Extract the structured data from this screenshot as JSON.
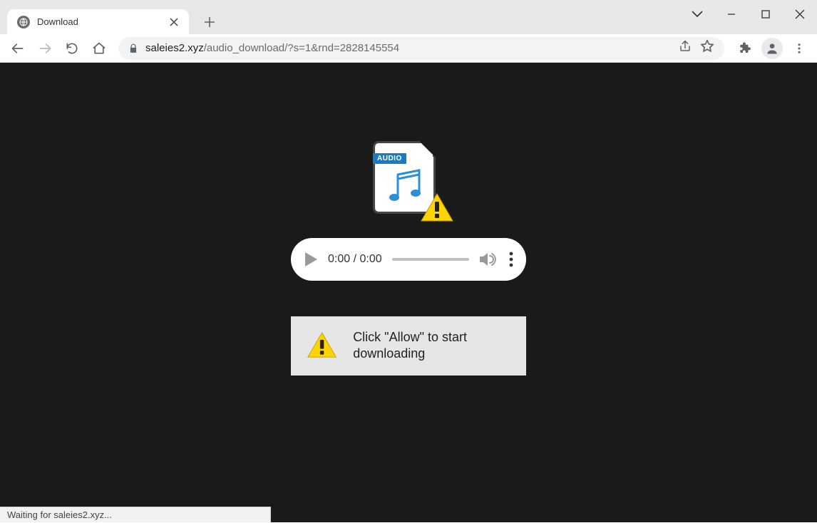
{
  "browser": {
    "tab": {
      "title": "Download"
    },
    "url_host": "saleies2.xyz",
    "url_path": "/audio_download/?s=1&rnd=2828145554",
    "status_text": "Waiting for saleies2.xyz..."
  },
  "page": {
    "audio_badge": "AUDIO",
    "player": {
      "current": "0:00",
      "sep": " / ",
      "total": "0:00"
    },
    "message": "Click \"Allow\" to start downloading"
  }
}
